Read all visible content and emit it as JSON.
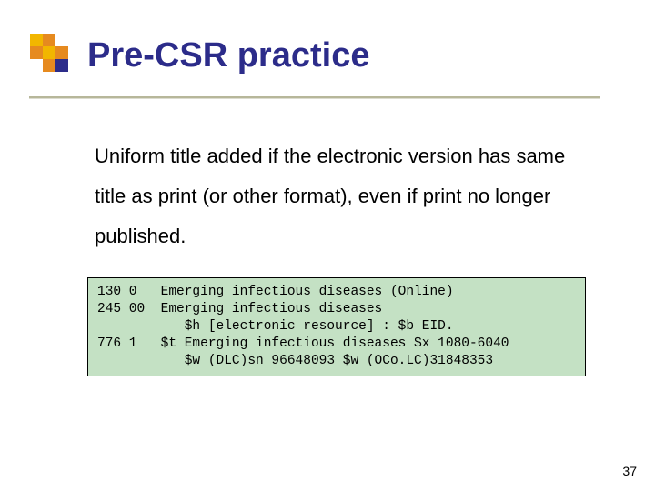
{
  "title": "Pre-CSR practice",
  "body": "Uniform title added if the electronic version has same title as print (or other format), even if print no longer published.",
  "marc": {
    "l1": "130 0   Emerging infectious diseases (Online)",
    "l2": "245 00  Emerging infectious diseases",
    "l3": "           $h [electronic resource] : $b EID.",
    "l4": "776 1   $t Emerging infectious diseases $x 1080-6040",
    "l5": "           $w (DLC)sn 96648093 $w (OCo.LC)31848353"
  },
  "page_number": "37",
  "decor": {
    "colors": {
      "yellow": "#f2b600",
      "orange": "#e68a1f",
      "navy": "#2c2c8a",
      "code_bg": "#c4e1c4"
    }
  }
}
